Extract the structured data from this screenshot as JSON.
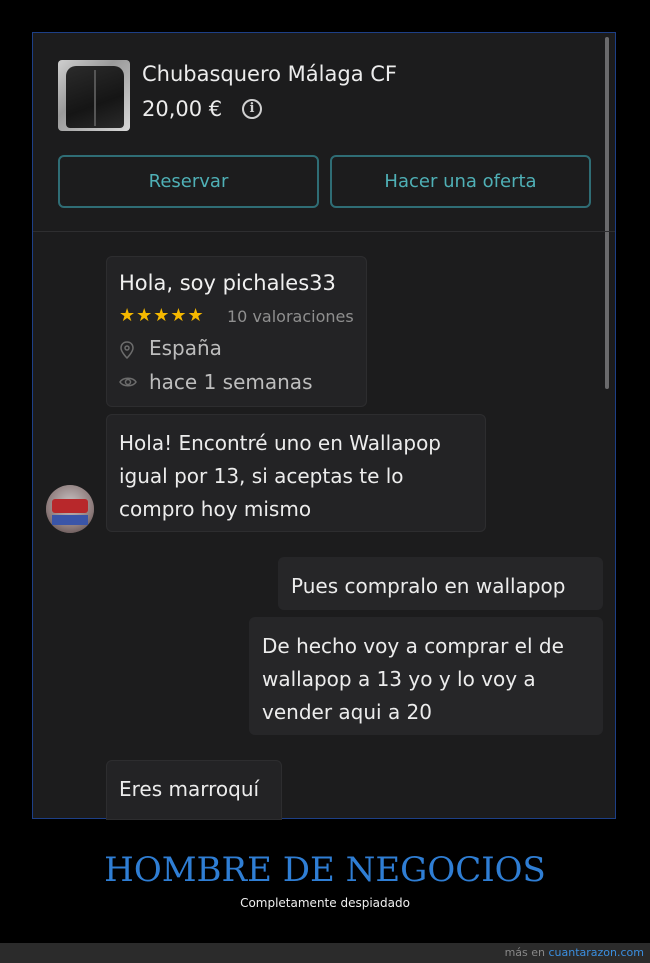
{
  "product": {
    "title": "Chubasquero Málaga CF",
    "price": "20,00 €",
    "info_icon": "info-icon",
    "image_icon": "jacket-photo"
  },
  "actions": {
    "reserve_label": "Reservar",
    "offer_label": "Hacer una oferta"
  },
  "seller": {
    "greeting": "Hola, soy pichales33",
    "stars": "★★★★★",
    "rating_count": 5,
    "ratings_text": "10 valoraciones",
    "country": "España",
    "last_seen": "hace 1 semanas",
    "country_icon": "location-pin-icon",
    "seen_icon": "eye-icon"
  },
  "messages": {
    "incoming_1_lines": [
      "Hola! Encontré uno en Wallapop",
      "igual por 13, si aceptas te lo",
      "compro hoy mismo"
    ],
    "outgoing_1": "Pues compralo en wallapop",
    "outgoing_2_lines": [
      "De hecho voy a comprar el de",
      "wallapop a 13 yo y lo voy a",
      "vender aqui a 20"
    ],
    "incoming_2": "Eres marroquí"
  },
  "caption": {
    "title": "HOMBRE DE NEGOCIOS",
    "subtitle": "Completamente despiadado"
  },
  "footer": {
    "prefix": "más en ",
    "link": "cuantarazon.com"
  },
  "colors": {
    "accent": "#4fb0b6",
    "stars": "#f5b800",
    "caption": "#2f7ed4"
  }
}
